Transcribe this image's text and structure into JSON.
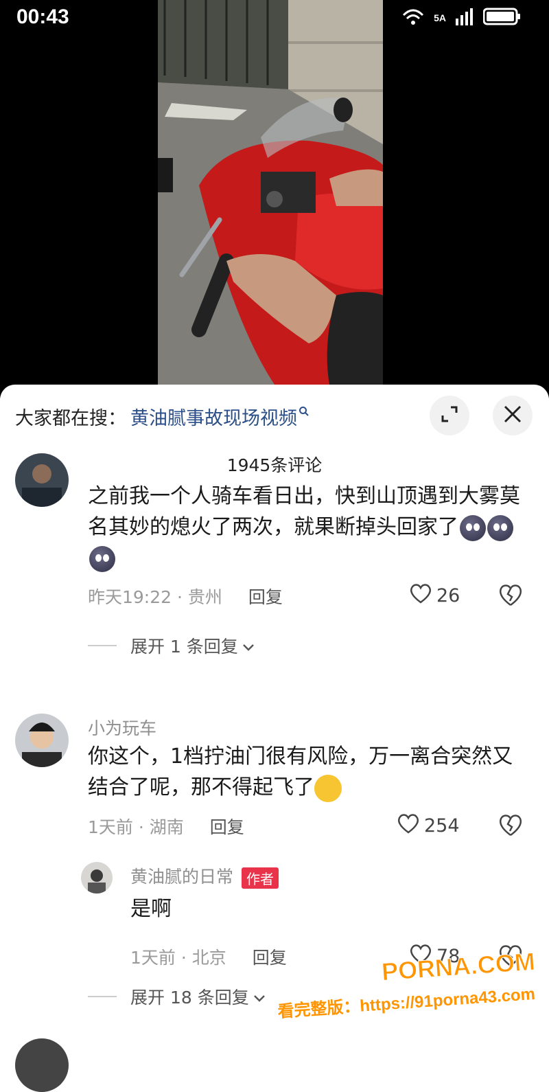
{
  "status_bar": {
    "time": "00:43",
    "network": "5A"
  },
  "search_bar": {
    "prefix": "大家都在搜：",
    "keyword": "黄油腻事故现场视频"
  },
  "comments_header": {
    "count_label": "1945条评论"
  },
  "comments": [
    {
      "username": "",
      "text": "之前我一个人骑车看日出，快到山顶遇到大雾莫名其妙的熄火了两次，就果断掉头回家了",
      "time_location": "昨天19:22 · 贵州",
      "reply_label": "回复",
      "likes": "26",
      "expand_label": "展开 1 条回复"
    },
    {
      "username": "小为玩车",
      "text": "你这个，1档拧油门很有风险，万一离合突然又结合了呢，那不得起飞了",
      "time_location": "1天前 · 湖南",
      "reply_label": "回复",
      "likes": "254",
      "reply": {
        "username": "黄油腻的日常",
        "badge": "作者",
        "text": "是啊",
        "time_location": "1天前 · 北京",
        "reply_label": "回复",
        "likes": "78"
      },
      "expand_label": "展开 18 条回复"
    }
  ],
  "watermark": {
    "line1": "PORNA.COM",
    "line2": "看完整版：https://91porna43.com"
  }
}
